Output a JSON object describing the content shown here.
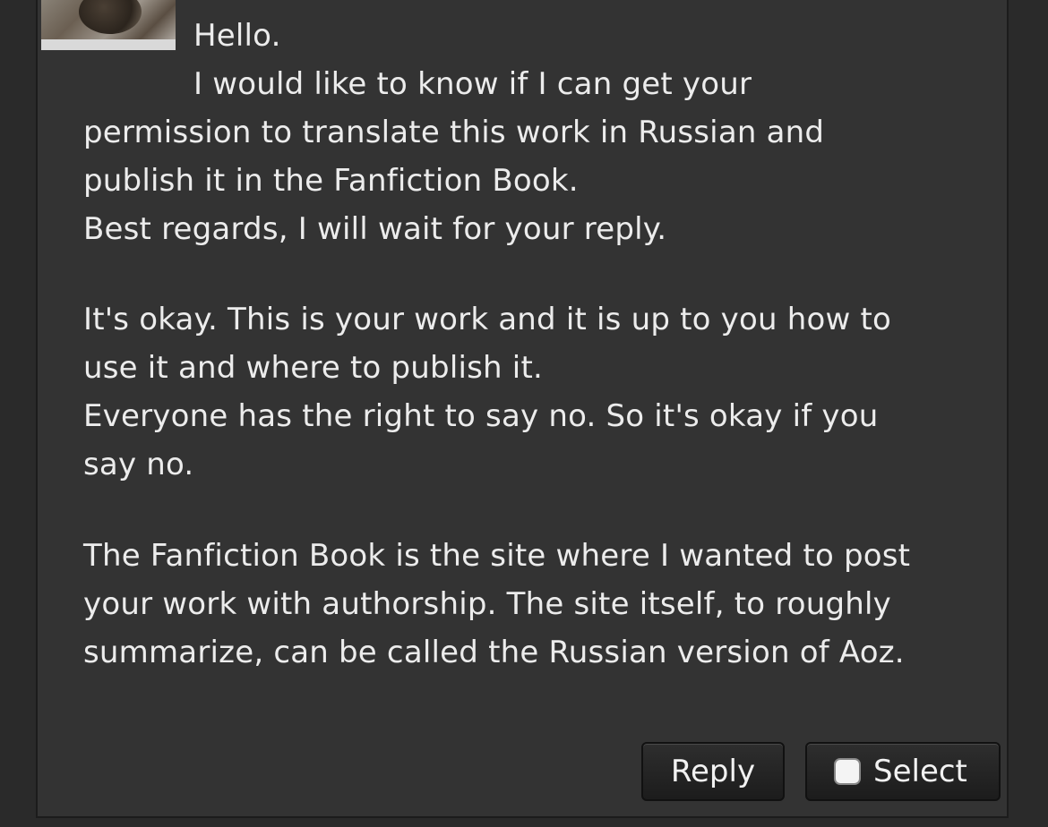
{
  "message": {
    "lines": [
      "Hello.",
      "I would like to know if I can get your",
      "permission to translate this work in Russian and",
      "publish it in the Fanfiction Book.",
      "Best regards, I will wait for your reply.",
      "It's okay. This is your work and it is up to you how to",
      "use it and where to publish it.",
      "Everyone has the right to say no. So it's okay if you",
      "say no.",
      "The Fanfiction Book is the site where I wanted to post",
      "your work with authorship. The site itself, to roughly",
      "summarize, can be called the Russian version of Aoz."
    ]
  },
  "actions": {
    "reply_label": "Reply",
    "select_label": "Select"
  },
  "icons": {
    "avatar": "user-avatar-image",
    "checkbox": "checkbox-icon"
  },
  "colors": {
    "background": "#333333",
    "text": "#ececec",
    "button": "#1e1e1e"
  }
}
